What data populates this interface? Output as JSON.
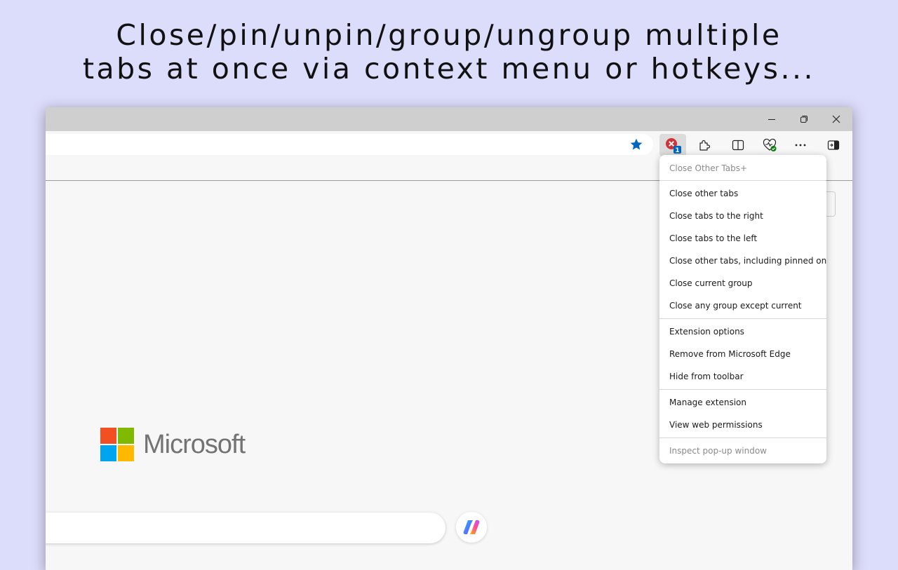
{
  "headline": {
    "line1": "Close/pin/unpin/group/ungroup multiple",
    "line2": "tabs at once via context menu or hotkeys..."
  },
  "window_controls": {
    "minimize": "minimize-icon",
    "restore": "restore-icon",
    "close": "close-icon"
  },
  "toolbar": {
    "favorite": "star-icon",
    "extension_badge": "1",
    "buttons": [
      "close-tabs-extension-icon",
      "extensions-puzzle-icon",
      "split-screen-icon",
      "browser-essentials-icon",
      "more-options-icon",
      "sidebar-toggle-icon"
    ]
  },
  "logo": {
    "text": "Microsoft"
  },
  "context_menu": {
    "header": "Close Other Tabs+",
    "group1": [
      "Close other tabs",
      "Close tabs to the right",
      "Close tabs to the left",
      "Close other tabs, including pinned ones",
      "Close current group",
      "Close any group except current"
    ],
    "group2": [
      "Extension options",
      "Remove from Microsoft Edge",
      "Hide from toolbar"
    ],
    "group3": [
      "Manage extension",
      "View web permissions"
    ],
    "footer": "Inspect pop-up window"
  },
  "colors": {
    "background": "#dcdcfb",
    "accent_blue": "#0067c0",
    "badge_red": "#d13438",
    "ms_red": "#f25022",
    "ms_green": "#7fba00",
    "ms_blue": "#00a4ef",
    "ms_yellow": "#ffb900"
  }
}
